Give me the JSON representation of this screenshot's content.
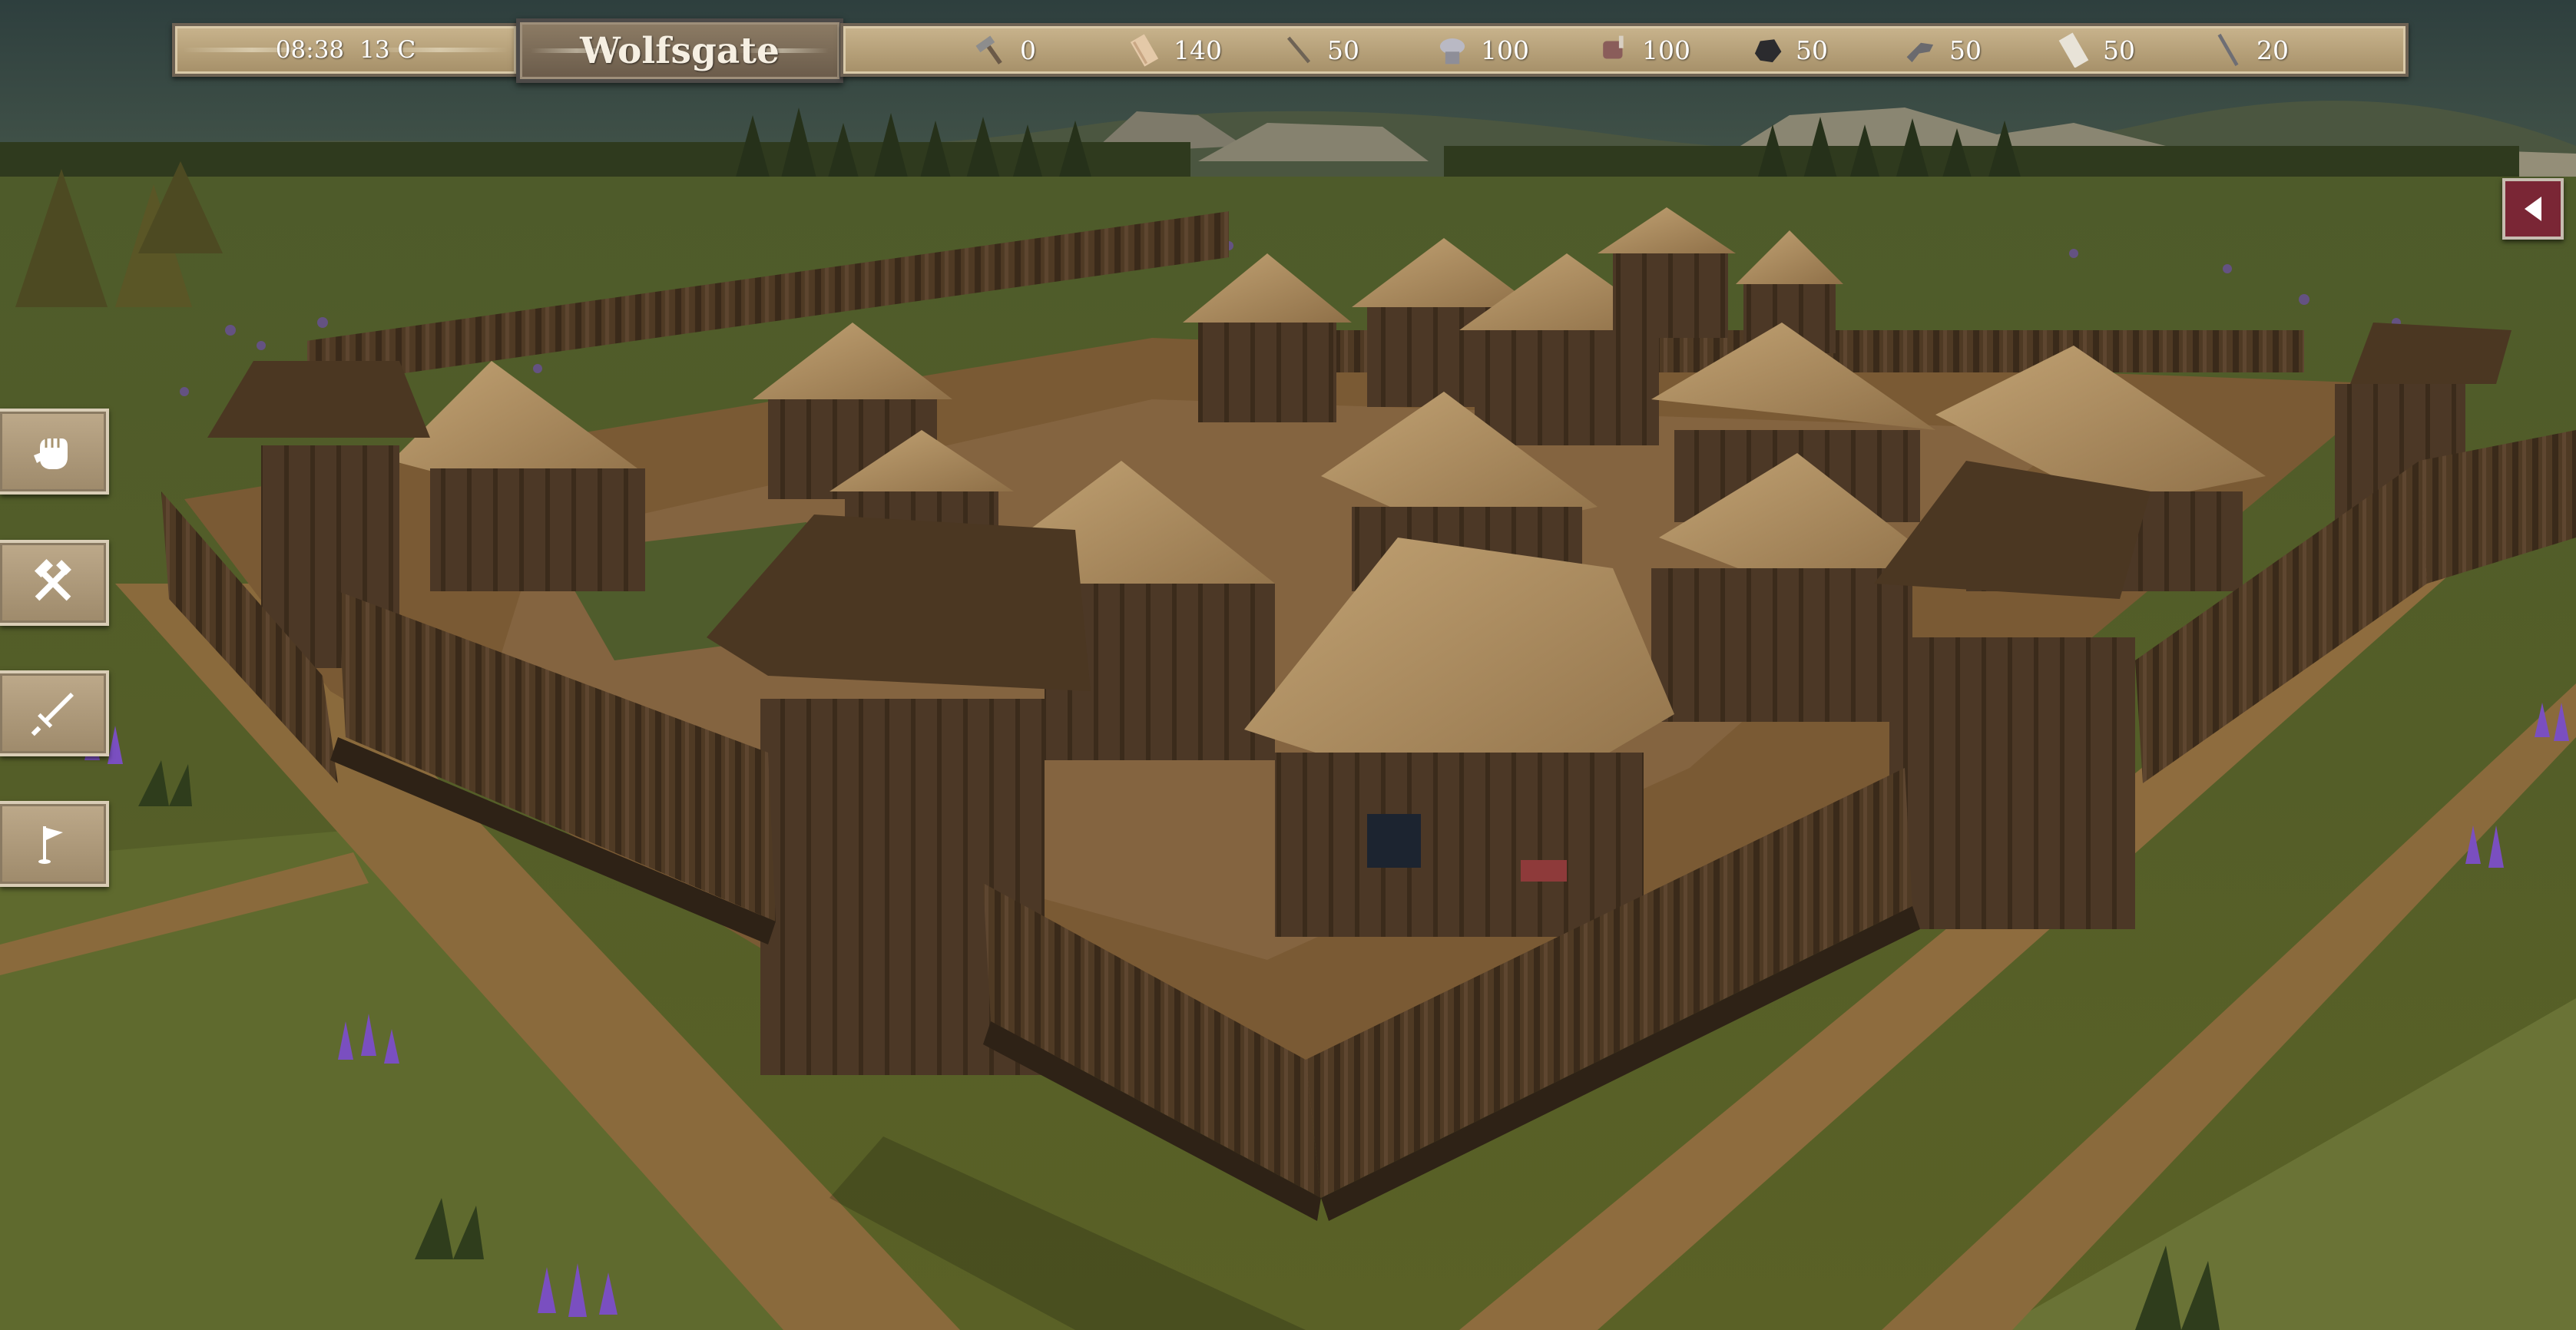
{
  "hud": {
    "time": "08:38",
    "temperature": "13 C",
    "town_name": "Wolfsgate"
  },
  "resources": [
    {
      "icon": "hammer-icon",
      "value": "0"
    },
    {
      "icon": "wood-plank-icon",
      "value": "140"
    },
    {
      "icon": "stick-icon",
      "value": "50"
    },
    {
      "icon": "ore-icon",
      "value": "100"
    },
    {
      "icon": "meat-icon",
      "value": "100"
    },
    {
      "icon": "coal-icon",
      "value": "50"
    },
    {
      "icon": "tool-icon",
      "value": "50"
    },
    {
      "icon": "paper-icon",
      "value": "50"
    },
    {
      "icon": "sword-blade-icon",
      "value": "20"
    }
  ],
  "side_menu": [
    {
      "name": "fist-button",
      "icon": "fist-icon"
    },
    {
      "name": "build-button",
      "icon": "hammer-crossed-icon"
    },
    {
      "name": "sword-button",
      "icon": "sword-icon"
    },
    {
      "name": "flag-button",
      "icon": "flag-icon"
    }
  ],
  "colors": {
    "hud_panel": "#b9a47e",
    "town_panel": "#7d6d58",
    "collapse_button": "#7a2635",
    "grass": "#5c6328",
    "dirt_path": "#8a6a3c",
    "palisade": "#3e2c1c",
    "roof": "#a88a5c"
  }
}
